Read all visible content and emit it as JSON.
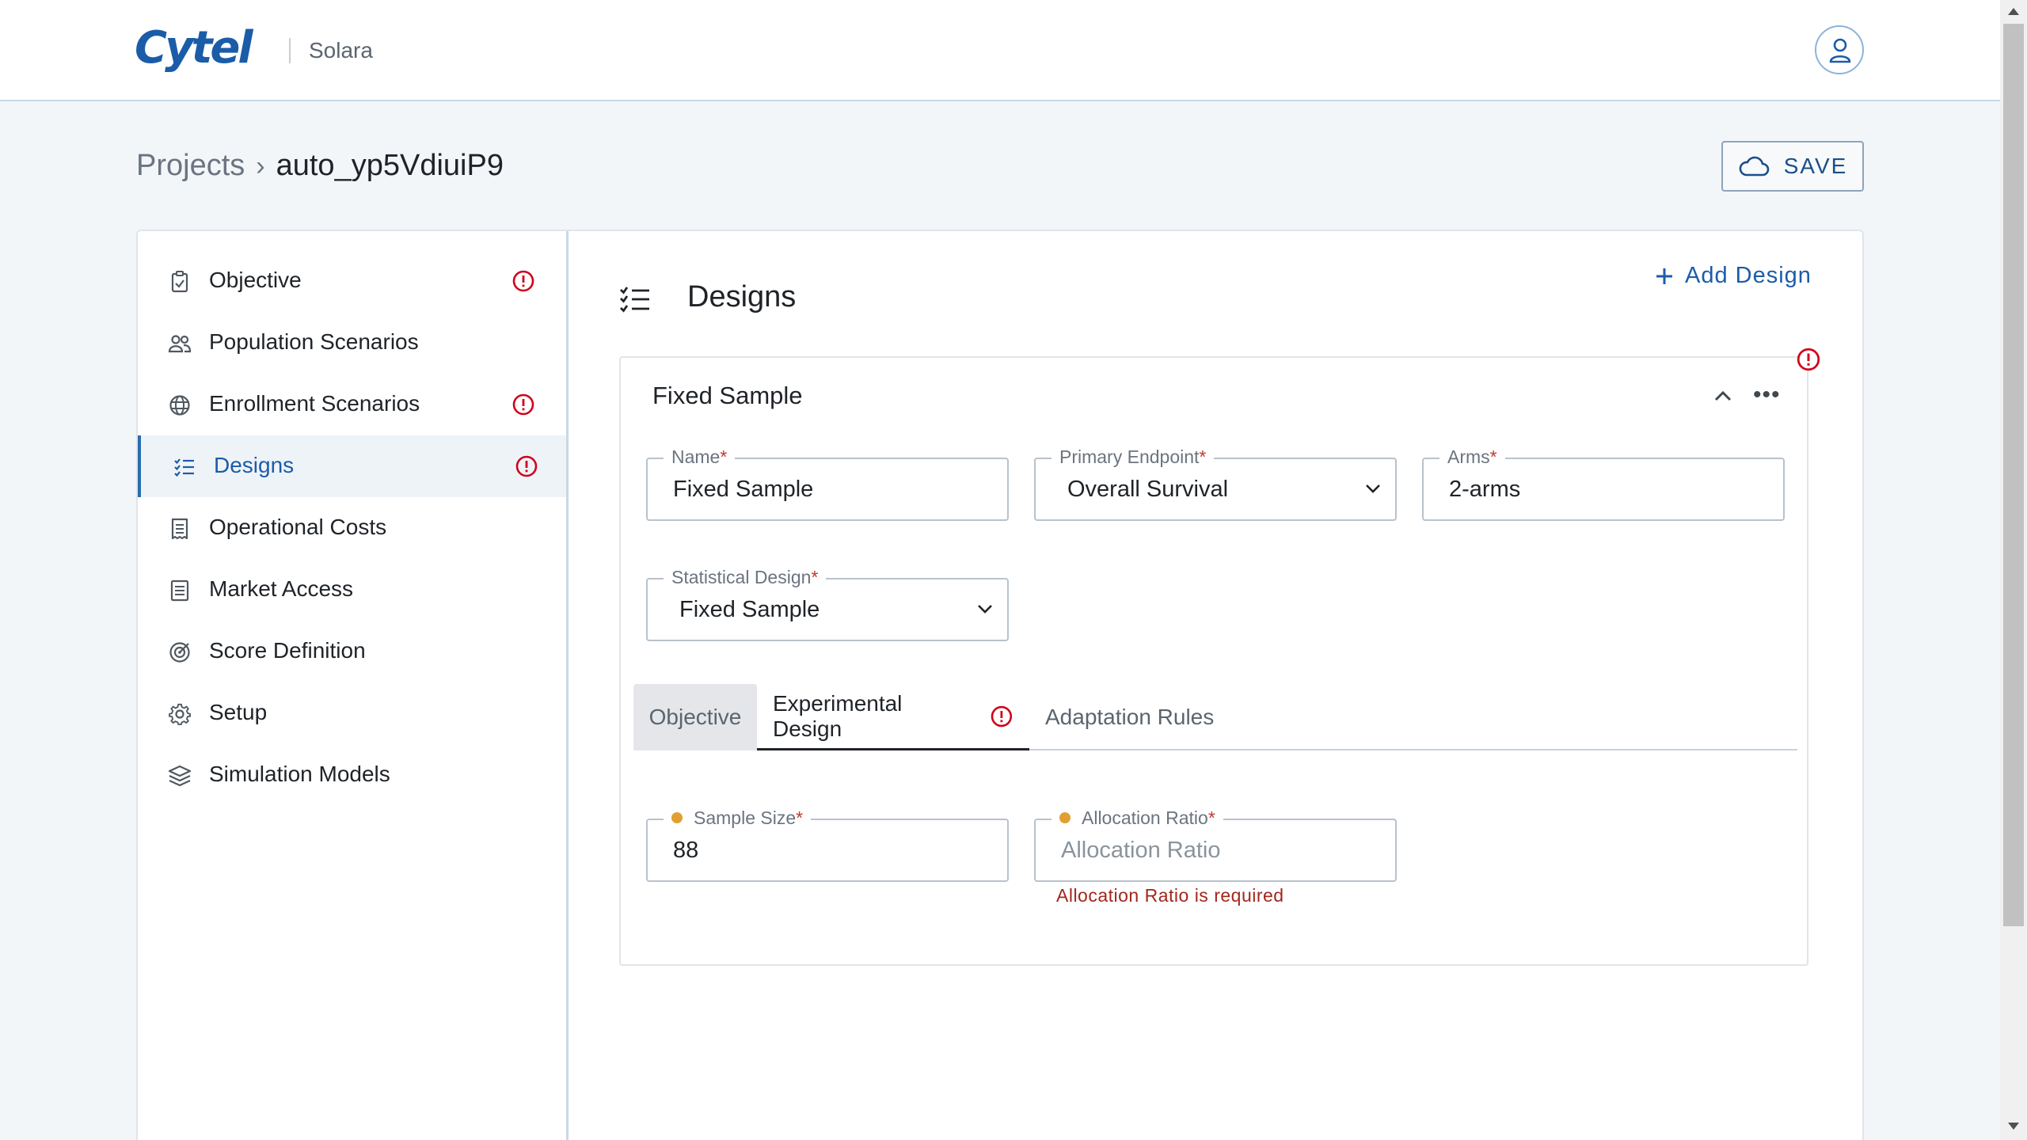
{
  "header": {
    "logo_text": "Cytel",
    "app_name": "Solara",
    "avatar_icon": "user-icon"
  },
  "breadcrumb": {
    "root": "Projects",
    "separator": "›",
    "current": "auto_yp5VdiuiP9"
  },
  "toolbar": {
    "save_label": "SAVE",
    "save_icon": "cloud-icon"
  },
  "sidebar": {
    "items": [
      {
        "label": "Objective",
        "icon": "clipboard-check-icon",
        "warning": true,
        "active": false
      },
      {
        "label": "Population Scenarios",
        "icon": "users-icon",
        "warning": false,
        "active": false
      },
      {
        "label": "Enrollment Scenarios",
        "icon": "globe-icon",
        "warning": true,
        "active": false
      },
      {
        "label": "Designs",
        "icon": "checklist-icon",
        "warning": true,
        "active": true
      },
      {
        "label": "Operational Costs",
        "icon": "receipt-icon",
        "warning": false,
        "active": false
      },
      {
        "label": "Market Access",
        "icon": "document-icon",
        "warning": false,
        "active": false
      },
      {
        "label": "Score Definition",
        "icon": "target-icon",
        "warning": false,
        "active": false
      },
      {
        "label": "Setup",
        "icon": "gear-icon",
        "warning": false,
        "active": false
      },
      {
        "label": "Simulation Models",
        "icon": "layers-icon",
        "warning": false,
        "active": false
      }
    ]
  },
  "main": {
    "title": "Designs",
    "add_design_label": "Add Design",
    "design_card": {
      "title": "Fixed Sample",
      "fields": {
        "name": {
          "label": "Name",
          "required_mark": "*",
          "value": "Fixed Sample"
        },
        "primary_endpoint": {
          "label": "Primary Endpoint",
          "required_mark": "*",
          "value": "Overall Survival"
        },
        "arms": {
          "label": "Arms",
          "required_mark": "*",
          "value": "2-arms"
        },
        "statistical_design": {
          "label": "Statistical Design",
          "required_mark": "*",
          "value": "Fixed Sample"
        }
      },
      "tabs": [
        {
          "label": "Objective"
        },
        {
          "label": "Experimental Design"
        },
        {
          "label": "Adaptation Rules"
        }
      ],
      "active_tab": "Experimental Design",
      "experimental": {
        "sample_size": {
          "label": "Sample Size",
          "required_mark": "*",
          "value": "88"
        },
        "allocation_ratio": {
          "label": "Allocation Ratio",
          "required_mark": "*",
          "placeholder": "Allocation Ratio",
          "value": ""
        },
        "error": "Allocation Ratio is required"
      }
    }
  },
  "colors": {
    "brand": "#1b5ca8",
    "warning": "#d0021b",
    "error_text": "#a3261c",
    "pending_dot": "#e0a030"
  }
}
